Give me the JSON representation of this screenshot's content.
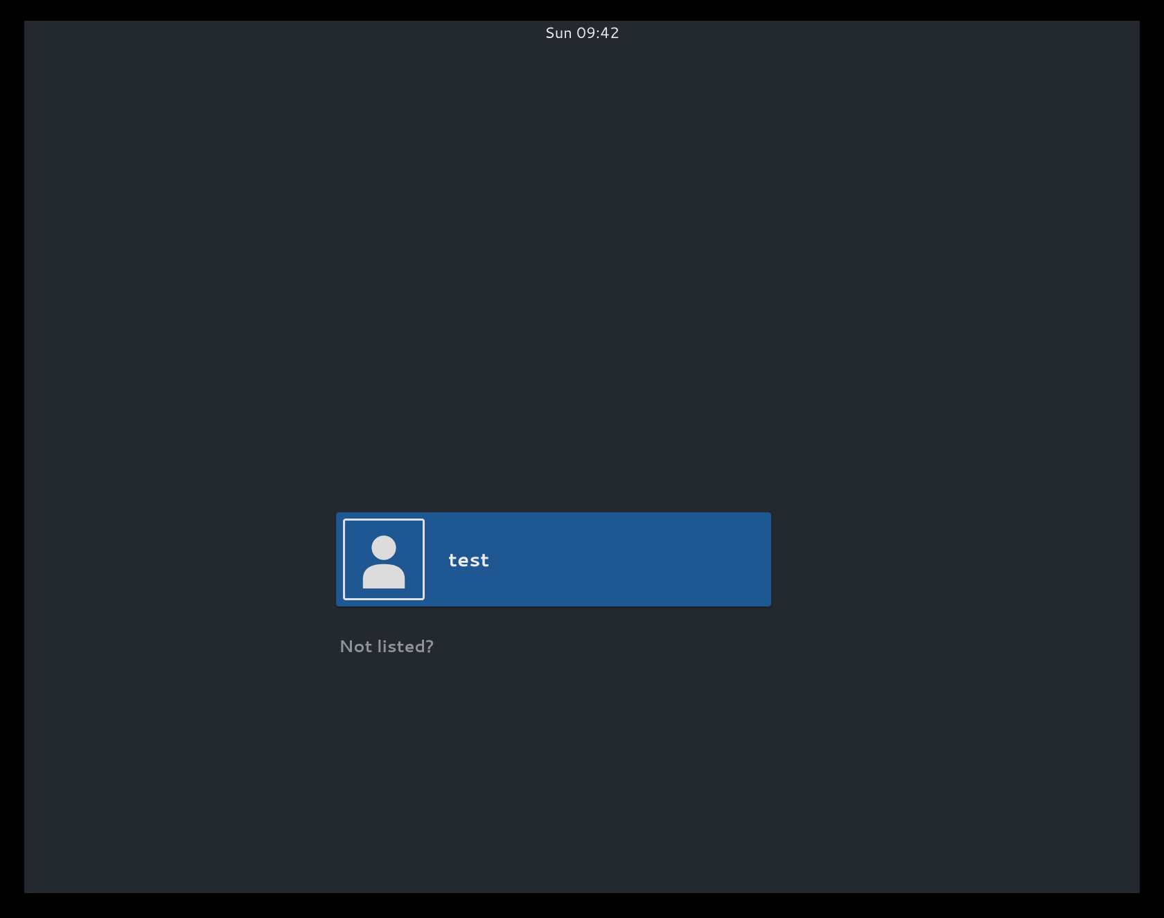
{
  "topbar": {
    "datetime": "Sun 09:42"
  },
  "login": {
    "users": [
      {
        "name": "test",
        "avatar_icon": "person-icon"
      }
    ],
    "not_listed_label": "Not listed?"
  },
  "colors": {
    "background": "#242930",
    "accent": "#1f5793",
    "text": "#eeeeee",
    "muted": "#8f9499"
  }
}
